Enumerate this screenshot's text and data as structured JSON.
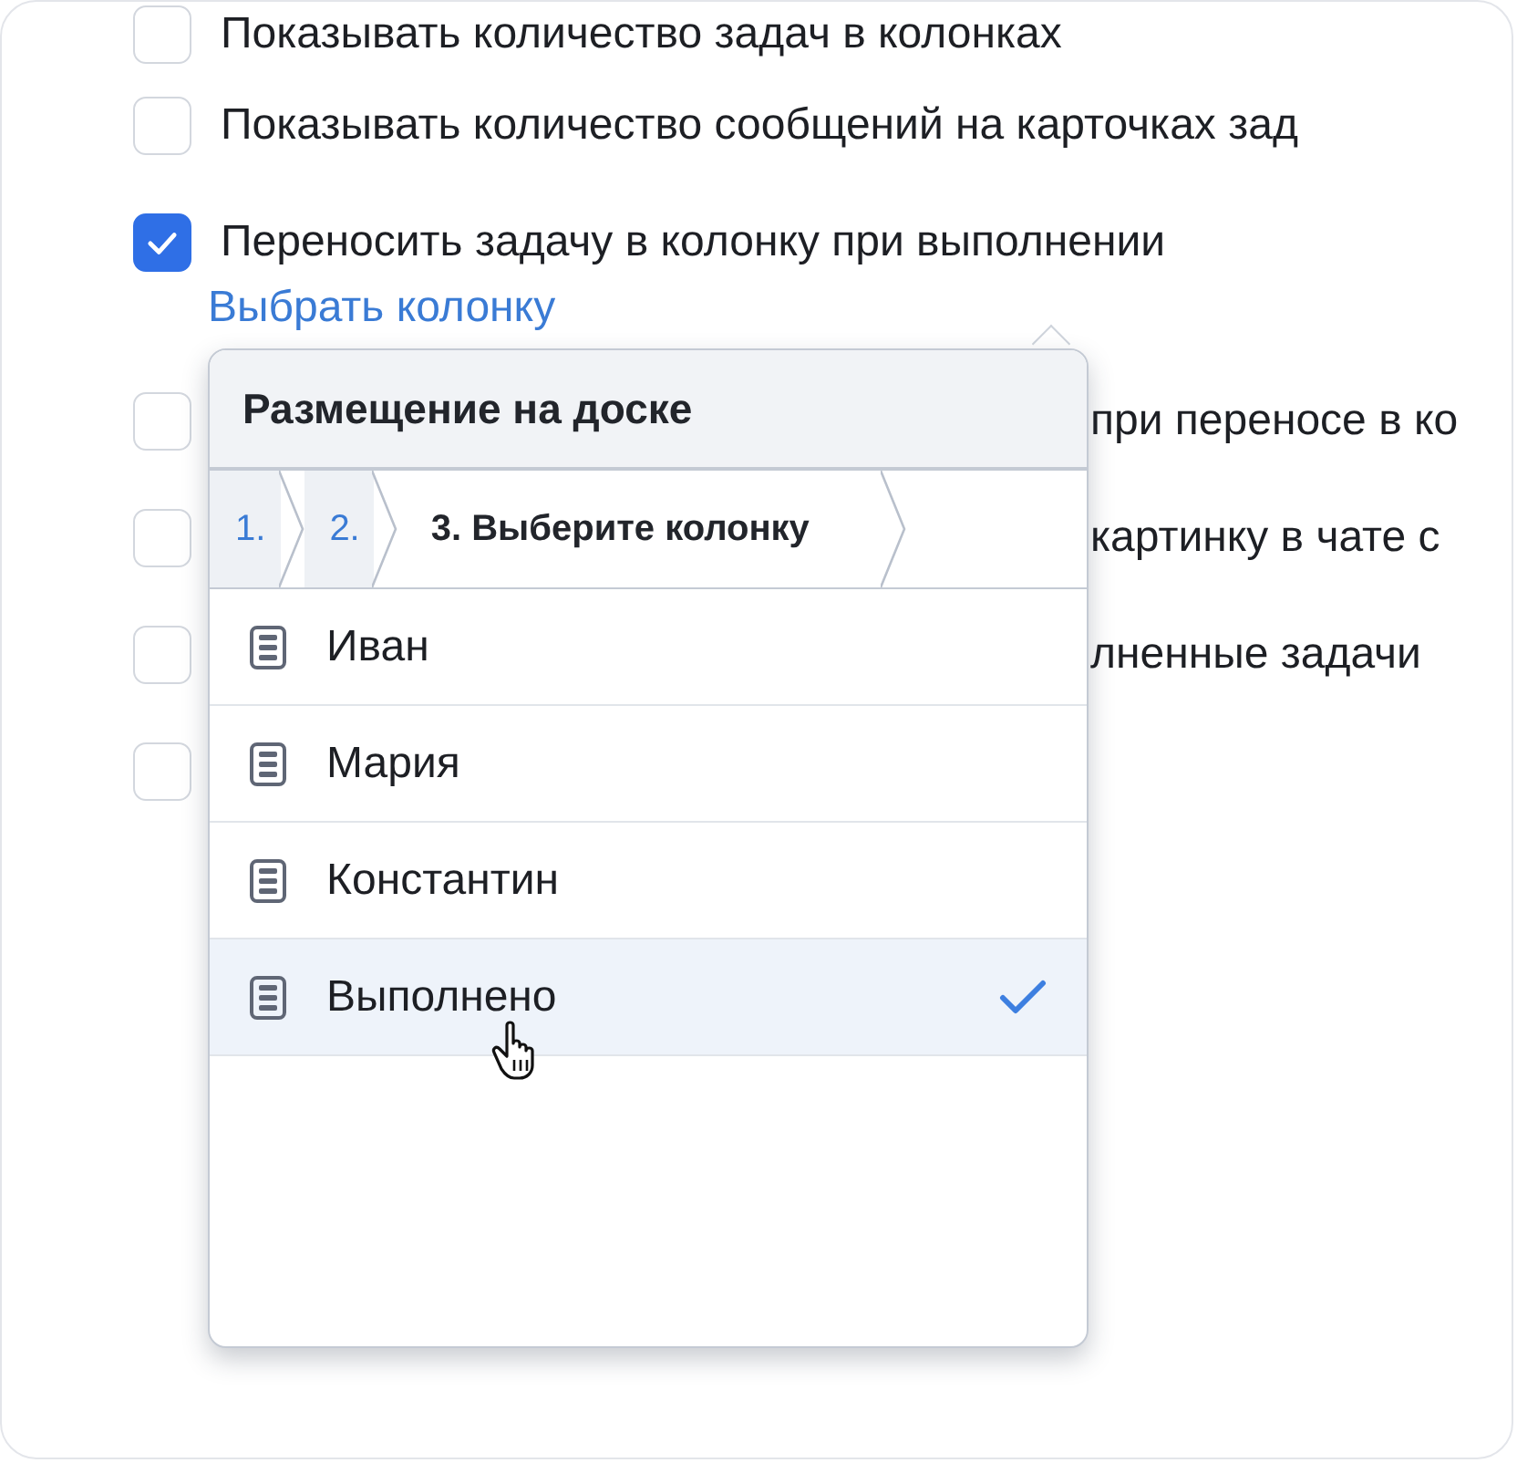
{
  "settings": [
    {
      "kind": "full",
      "label": "Показывать количество задач в колонках",
      "checked": false
    },
    {
      "kind": "full",
      "label": "Показывать количество сообщений на карточках зад",
      "checked": false
    },
    {
      "kind": "full",
      "label": "Переносить задачу в колонку при выполнении",
      "checked": true,
      "link": "Выбрать колонку"
    },
    {
      "kind": "covered",
      "label": "при переносе в ко",
      "checked": false
    },
    {
      "kind": "covered",
      "label": "картинку в чате с",
      "checked": false
    },
    {
      "kind": "covered",
      "label": "лненные задачи",
      "checked": false
    },
    {
      "kind": "covered",
      "checked": false
    }
  ],
  "popup": {
    "title": "Размещение на доске",
    "steps": [
      {
        "label": "1.",
        "selected": false
      },
      {
        "label": "2.",
        "selected": false
      },
      {
        "label": "3. Выберите колонку",
        "selected": true
      }
    ],
    "columns": [
      {
        "name": "Иван",
        "selected": false
      },
      {
        "name": "Мария",
        "selected": false
      },
      {
        "name": "Константин",
        "selected": false
      },
      {
        "name": "Выполнено",
        "selected": true
      }
    ]
  }
}
